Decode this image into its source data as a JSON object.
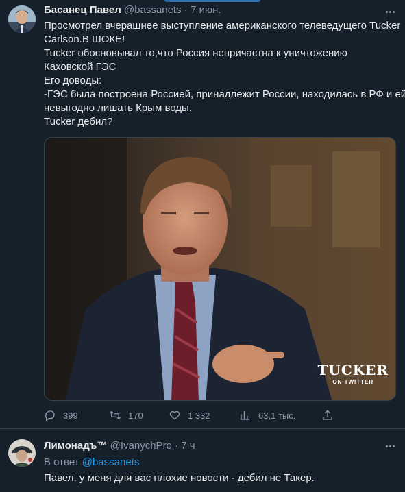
{
  "tweet": {
    "author_name": "Басанец Павел",
    "author_handle": "@bassanets",
    "separator": "·",
    "time": "7 июн.",
    "text_lines": [
      "Просмотрел вчерашнее выступление американского телеведущего Tucker",
      "Carlson.В ШОКЕ!",
      "Tucker обосновывал то,что Россия непричастна к уничтожению",
      "Каховской ГЭС",
      "Его доводы:",
      "-ГЭС была построена Россией, принадлежит России, находилась в РФ и ей",
      "невыгодно лишать Крым воды.",
      "Tucker дебил?"
    ],
    "media": {
      "watermark_main": "TUCKER",
      "watermark_sub": "ON TWITTER"
    },
    "actions": {
      "replies": "399",
      "retweets": "170",
      "likes": "1 332",
      "views": "63,1 тыс."
    },
    "icons": [
      "more-icon",
      "reply-icon",
      "retweet-icon",
      "like-icon",
      "views-icon",
      "share-icon"
    ]
  },
  "reply": {
    "author_name": "Лимонадъ™",
    "author_handle": "@IvanychPro",
    "separator": "·",
    "time": "7 ч",
    "reply_to_label": "В ответ",
    "reply_to_handle": "@bassanets",
    "text": "Павел, у меня для вас плохие новости - дебил не Такер."
  },
  "colors": {
    "background": "#15202b",
    "text": "#e7e9ea",
    "secondary": "#8b98a5",
    "accent": "#1d9bf0",
    "divider": "#38444d"
  }
}
